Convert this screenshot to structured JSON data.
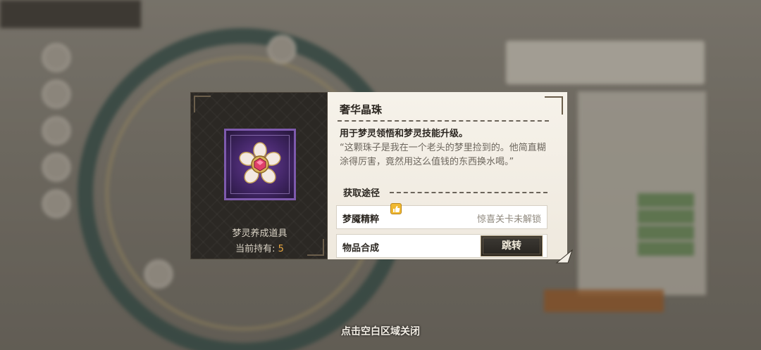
{
  "item": {
    "name": "奢华晶珠",
    "type_label": "梦灵养成道具",
    "owned_label": "当前持有:",
    "owned_count": "5",
    "usage": "用于梦灵领悟和梦灵技能升级。",
    "quote": "“这颗珠子是我在一个老头的梦里捡到的。他简直糊涂得厉害，竟然用这么值钱的东西换水喝。”",
    "icon": "jewel-flower-icon",
    "rarity_color": "#7e5aae"
  },
  "sources": {
    "heading": "获取途径",
    "rows": [
      {
        "name": "梦魇精粹",
        "status": "惊喜关卡未解锁",
        "badge_icon": "thumbs-up-icon"
      },
      {
        "name": "物品合成",
        "action": "跳转"
      }
    ]
  },
  "close_hint": "点击空白区域关闭"
}
